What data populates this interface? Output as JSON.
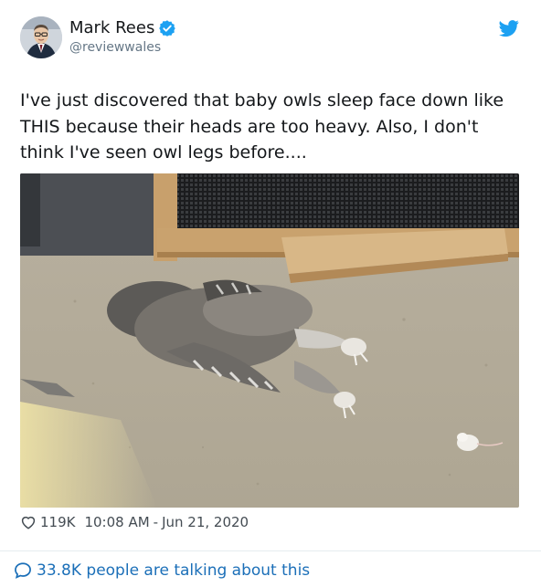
{
  "author": {
    "display_name": "Mark Rees",
    "handle": "@reviewwales",
    "verified": true
  },
  "tweet": {
    "text": "I've just discovered that baby owls sleep face down like THIS because their heads are too heavy. Also, I don't think I've seen owl legs before...."
  },
  "stats": {
    "likes": "119K",
    "time": "10:08 AM",
    "separator": "-",
    "date": "Jun 21, 2020"
  },
  "conversation": {
    "label": "33.8K people are talking about this"
  },
  "icons": {
    "verified": "verified-badge-icon",
    "logo": "twitter-bird-icon",
    "like": "heart-icon",
    "reply": "speech-bubble-icon"
  },
  "colors": {
    "brand": "#1da1f2",
    "link": "#1b6fb8",
    "secondary_text": "#657786"
  }
}
